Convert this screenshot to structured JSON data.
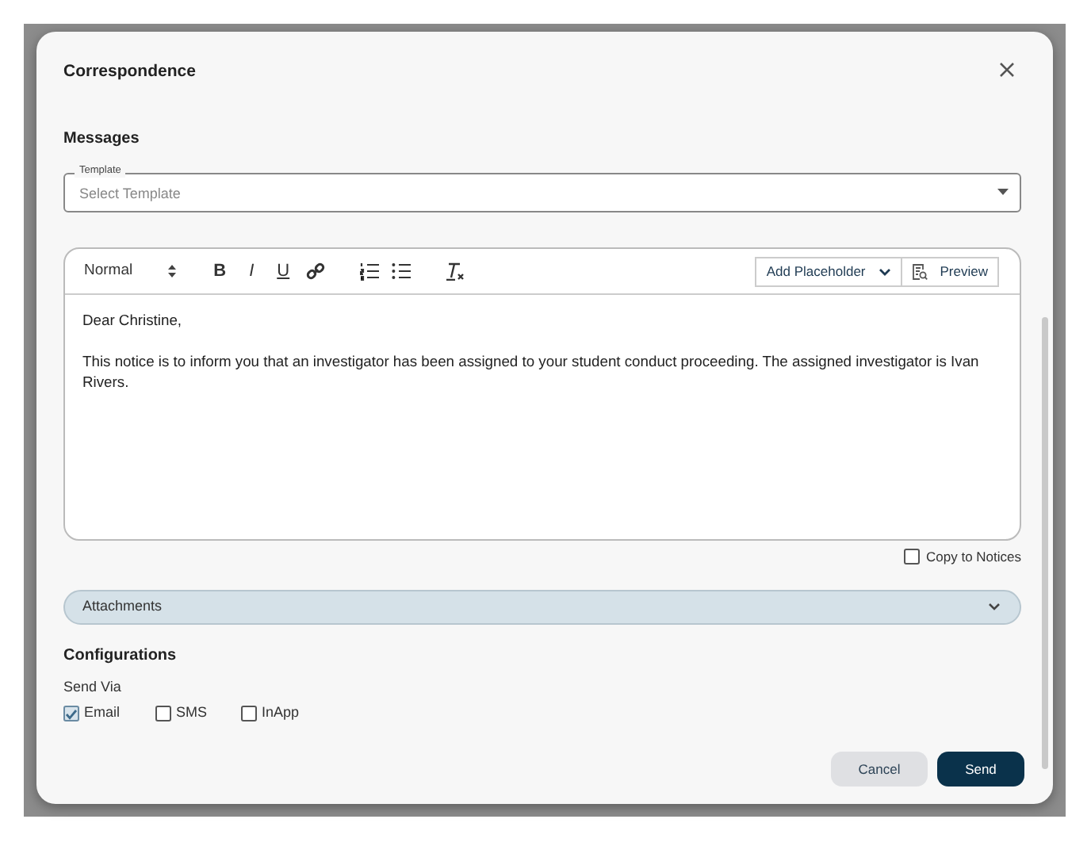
{
  "dialog": {
    "title": "Correspondence"
  },
  "messages": {
    "heading": "Messages",
    "template": {
      "label": "Template",
      "placeholder": "Select Template"
    },
    "editor": {
      "format": "Normal",
      "tools": [
        {
          "kind": "bold",
          "label": "B"
        },
        {
          "kind": "italic",
          "label": "I"
        },
        {
          "kind": "underline",
          "label": "U"
        },
        {
          "kind": "link"
        },
        {
          "kind": "ordered-list"
        },
        {
          "kind": "bullet-list"
        },
        {
          "kind": "clear-format"
        }
      ],
      "placeholder_button": "Add Placeholder",
      "preview_button": "Preview",
      "body": [
        "Dear Christine,",
        "This notice is to inform you that an investigator has been assigned to your student conduct proceeding. The assigned investigator is Ivan Rivers."
      ]
    },
    "copy_to_notices": {
      "label": "Copy to Notices",
      "checked": false
    }
  },
  "attachments": {
    "label": "Attachments",
    "expanded": false
  },
  "configurations": {
    "heading": "Configurations",
    "send_via_label": "Send Via",
    "channels": [
      {
        "label": "Email",
        "checked": true
      },
      {
        "label": "SMS",
        "checked": false
      },
      {
        "label": "InApp",
        "checked": false
      }
    ]
  },
  "buttons": [
    {
      "label": "Cancel",
      "kind": "secondary"
    },
    {
      "label": "Send",
      "kind": "primary"
    }
  ]
}
